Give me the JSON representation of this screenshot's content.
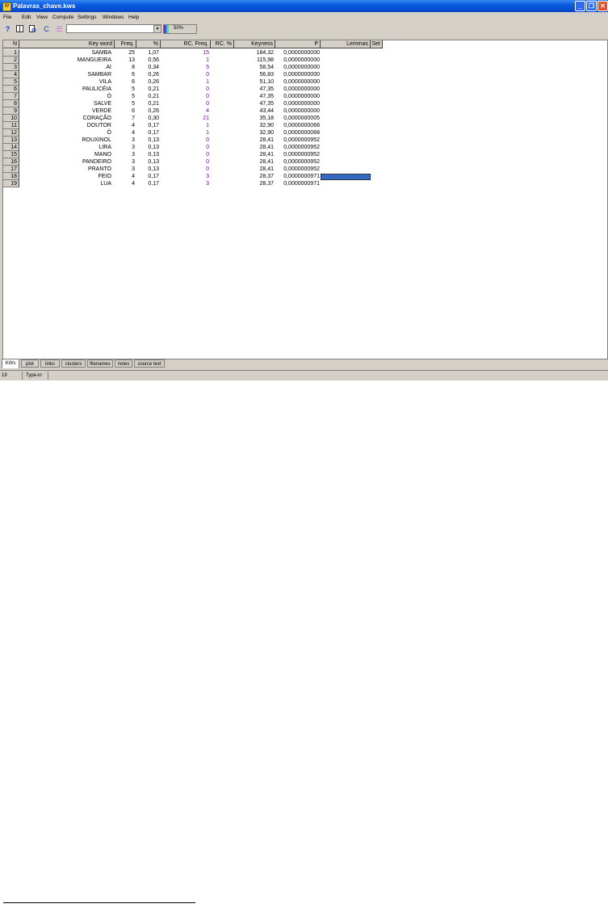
{
  "window": {
    "title": "Palavras_chave.kws"
  },
  "menu": [
    "File",
    "Edit",
    "View",
    "Compute",
    "Settings",
    "Windows",
    "Help"
  ],
  "toolbar": {
    "help_glyph": "?",
    "progress_label": "50%",
    "progress_value": 0.5
  },
  "table": {
    "headers": [
      "N",
      "Key word",
      "Freq.",
      "%",
      "RC. Freq.",
      "RC. %",
      "Keyness",
      "P",
      "Lemmas",
      "Set"
    ],
    "rows": [
      [
        "1",
        "SAMBA",
        "25",
        "1,07",
        "15",
        "",
        "184,32",
        "0,0000000000"
      ],
      [
        "2",
        "MANGUEIRA",
        "13",
        "0,56",
        "1",
        "",
        "115,98",
        "0,0000000000"
      ],
      [
        "3",
        "AI",
        "8",
        "0,34",
        "5",
        "",
        "58,54",
        "0,0000000000"
      ],
      [
        "4",
        "SAMBAR",
        "6",
        "0,26",
        "0",
        "",
        "56,83",
        "0,0000000000"
      ],
      [
        "5",
        "VILA",
        "6",
        "0,26",
        "1",
        "",
        "51,10",
        "0,0000000000"
      ],
      [
        "6",
        "PAULICÉIA",
        "5",
        "0,21",
        "0",
        "",
        "47,35",
        "0,0000000000"
      ],
      [
        "7",
        "Ó",
        "5",
        "0,21",
        "0",
        "",
        "47,35",
        "0,0000000000"
      ],
      [
        "8",
        "SALVE",
        "5",
        "0,21",
        "0",
        "",
        "47,35",
        "0,0000000000"
      ],
      [
        "9",
        "VERDE",
        "6",
        "0,26",
        "4",
        "",
        "43,44",
        "0,0000000000"
      ],
      [
        "10",
        "CORAÇÃO",
        "7",
        "0,30",
        "21",
        "",
        "35,18",
        "0,0000000005"
      ],
      [
        "11",
        "DOUTOR",
        "4",
        "0,17",
        "1",
        "",
        "32,90",
        "0,0000000068"
      ],
      [
        "12",
        "Ô",
        "4",
        "0,17",
        "1",
        "",
        "32,90",
        "0,0000000068"
      ],
      [
        "13",
        "ROUXINOL",
        "3",
        "0,13",
        "0",
        "",
        "28,41",
        "0,0000000952"
      ],
      [
        "14",
        "LIRA",
        "3",
        "0,13",
        "0",
        "",
        "28,41",
        "0,0000000952"
      ],
      [
        "15",
        "MANO",
        "3",
        "0,13",
        "0",
        "",
        "28,41",
        "0,0000000952"
      ],
      [
        "16",
        "PANDEIRO",
        "3",
        "0,13",
        "0",
        "",
        "28,41",
        "0,0000000952"
      ],
      [
        "17",
        "PRANTO",
        "3",
        "0,13",
        "0",
        "",
        "28,41",
        "0,0000000952"
      ],
      [
        "18",
        "FEIO",
        "4",
        "0,17",
        "3",
        "",
        "28,37",
        "0,0000000971"
      ],
      [
        "19",
        "LUA",
        "4",
        "0,17",
        "3",
        "",
        "28,37",
        "0,0000000971"
      ]
    ]
  },
  "tabs": [
    "KWs",
    "plot",
    "links",
    "clusters",
    "filenames",
    "notes",
    "source text"
  ],
  "status": {
    "count": "19",
    "mode": "Type-in"
  },
  "colors": {
    "titlebar": "#0a5be0",
    "rc_text": "#8b00b4",
    "selection": "#316ac5"
  }
}
